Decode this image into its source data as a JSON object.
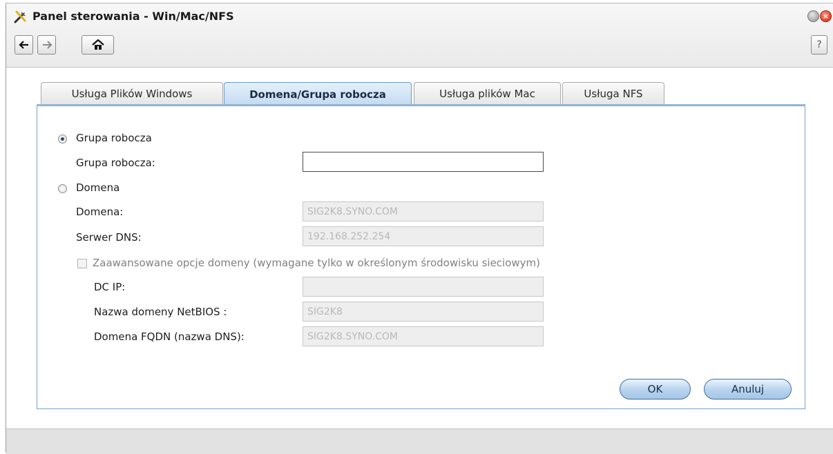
{
  "window": {
    "title": "Panel sterowania - Win/Mac/NFS",
    "close_glyph": "×",
    "help_label": "?"
  },
  "icons": {
    "app": "control-panel-icon",
    "back": "arrow-left-icon",
    "forward": "arrow-right-icon",
    "home": "home-icon"
  },
  "tabs": [
    {
      "label": "Usługa Plików Windows",
      "active": false
    },
    {
      "label": "Domena/Grupa robocza",
      "active": true
    },
    {
      "label": "Usługa plików Mac",
      "active": false
    },
    {
      "label": "Usługa NFS",
      "active": false
    }
  ],
  "workgroup": {
    "radio_label": "Grupa robocza",
    "selected": true,
    "field_label": "Grupa robocza:",
    "field_value": ""
  },
  "domain": {
    "radio_label": "Domena",
    "selected": false,
    "domain_label": "Domena:",
    "domain_value": "SIG2K8.SYNO.COM",
    "dns_label": "Serwer DNS:",
    "dns_value": "192.168.252.254"
  },
  "advanced": {
    "checkbox_label": "Zaawansowane opcje domeny (wymagane tylko w określonym środowisku sieciowym)",
    "checked": false,
    "dcip_label": "DC IP:",
    "dcip_value": "",
    "netbios_label": "Nazwa domeny NetBIOS :",
    "netbios_value": "SIG2K8",
    "fqdn_label": "Domena FQDN (nazwa DNS):",
    "fqdn_value": "SIG2K8.SYNO.COM"
  },
  "buttons": {
    "ok": "OK",
    "cancel": "Anuluj"
  },
  "colors": {
    "accent": "#6d99c6",
    "active_tab": "#c3daf0",
    "close": "#d42a12"
  }
}
